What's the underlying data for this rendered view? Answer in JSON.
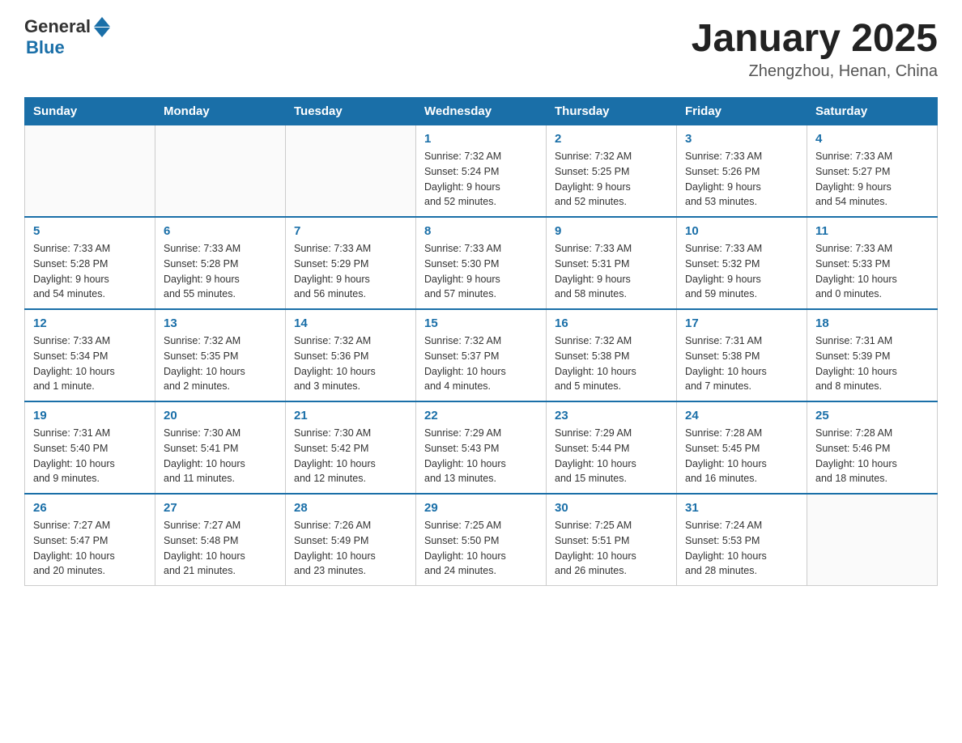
{
  "header": {
    "logo_general": "General",
    "logo_blue": "Blue",
    "month_title": "January 2025",
    "location": "Zhengzhou, Henan, China"
  },
  "weekdays": [
    "Sunday",
    "Monday",
    "Tuesday",
    "Wednesday",
    "Thursday",
    "Friday",
    "Saturday"
  ],
  "weeks": [
    [
      {
        "day": "",
        "info": ""
      },
      {
        "day": "",
        "info": ""
      },
      {
        "day": "",
        "info": ""
      },
      {
        "day": "1",
        "info": "Sunrise: 7:32 AM\nSunset: 5:24 PM\nDaylight: 9 hours\nand 52 minutes."
      },
      {
        "day": "2",
        "info": "Sunrise: 7:32 AM\nSunset: 5:25 PM\nDaylight: 9 hours\nand 52 minutes."
      },
      {
        "day": "3",
        "info": "Sunrise: 7:33 AM\nSunset: 5:26 PM\nDaylight: 9 hours\nand 53 minutes."
      },
      {
        "day": "4",
        "info": "Sunrise: 7:33 AM\nSunset: 5:27 PM\nDaylight: 9 hours\nand 54 minutes."
      }
    ],
    [
      {
        "day": "5",
        "info": "Sunrise: 7:33 AM\nSunset: 5:28 PM\nDaylight: 9 hours\nand 54 minutes."
      },
      {
        "day": "6",
        "info": "Sunrise: 7:33 AM\nSunset: 5:28 PM\nDaylight: 9 hours\nand 55 minutes."
      },
      {
        "day": "7",
        "info": "Sunrise: 7:33 AM\nSunset: 5:29 PM\nDaylight: 9 hours\nand 56 minutes."
      },
      {
        "day": "8",
        "info": "Sunrise: 7:33 AM\nSunset: 5:30 PM\nDaylight: 9 hours\nand 57 minutes."
      },
      {
        "day": "9",
        "info": "Sunrise: 7:33 AM\nSunset: 5:31 PM\nDaylight: 9 hours\nand 58 minutes."
      },
      {
        "day": "10",
        "info": "Sunrise: 7:33 AM\nSunset: 5:32 PM\nDaylight: 9 hours\nand 59 minutes."
      },
      {
        "day": "11",
        "info": "Sunrise: 7:33 AM\nSunset: 5:33 PM\nDaylight: 10 hours\nand 0 minutes."
      }
    ],
    [
      {
        "day": "12",
        "info": "Sunrise: 7:33 AM\nSunset: 5:34 PM\nDaylight: 10 hours\nand 1 minute."
      },
      {
        "day": "13",
        "info": "Sunrise: 7:32 AM\nSunset: 5:35 PM\nDaylight: 10 hours\nand 2 minutes."
      },
      {
        "day": "14",
        "info": "Sunrise: 7:32 AM\nSunset: 5:36 PM\nDaylight: 10 hours\nand 3 minutes."
      },
      {
        "day": "15",
        "info": "Sunrise: 7:32 AM\nSunset: 5:37 PM\nDaylight: 10 hours\nand 4 minutes."
      },
      {
        "day": "16",
        "info": "Sunrise: 7:32 AM\nSunset: 5:38 PM\nDaylight: 10 hours\nand 5 minutes."
      },
      {
        "day": "17",
        "info": "Sunrise: 7:31 AM\nSunset: 5:38 PM\nDaylight: 10 hours\nand 7 minutes."
      },
      {
        "day": "18",
        "info": "Sunrise: 7:31 AM\nSunset: 5:39 PM\nDaylight: 10 hours\nand 8 minutes."
      }
    ],
    [
      {
        "day": "19",
        "info": "Sunrise: 7:31 AM\nSunset: 5:40 PM\nDaylight: 10 hours\nand 9 minutes."
      },
      {
        "day": "20",
        "info": "Sunrise: 7:30 AM\nSunset: 5:41 PM\nDaylight: 10 hours\nand 11 minutes."
      },
      {
        "day": "21",
        "info": "Sunrise: 7:30 AM\nSunset: 5:42 PM\nDaylight: 10 hours\nand 12 minutes."
      },
      {
        "day": "22",
        "info": "Sunrise: 7:29 AM\nSunset: 5:43 PM\nDaylight: 10 hours\nand 13 minutes."
      },
      {
        "day": "23",
        "info": "Sunrise: 7:29 AM\nSunset: 5:44 PM\nDaylight: 10 hours\nand 15 minutes."
      },
      {
        "day": "24",
        "info": "Sunrise: 7:28 AM\nSunset: 5:45 PM\nDaylight: 10 hours\nand 16 minutes."
      },
      {
        "day": "25",
        "info": "Sunrise: 7:28 AM\nSunset: 5:46 PM\nDaylight: 10 hours\nand 18 minutes."
      }
    ],
    [
      {
        "day": "26",
        "info": "Sunrise: 7:27 AM\nSunset: 5:47 PM\nDaylight: 10 hours\nand 20 minutes."
      },
      {
        "day": "27",
        "info": "Sunrise: 7:27 AM\nSunset: 5:48 PM\nDaylight: 10 hours\nand 21 minutes."
      },
      {
        "day": "28",
        "info": "Sunrise: 7:26 AM\nSunset: 5:49 PM\nDaylight: 10 hours\nand 23 minutes."
      },
      {
        "day": "29",
        "info": "Sunrise: 7:25 AM\nSunset: 5:50 PM\nDaylight: 10 hours\nand 24 minutes."
      },
      {
        "day": "30",
        "info": "Sunrise: 7:25 AM\nSunset: 5:51 PM\nDaylight: 10 hours\nand 26 minutes."
      },
      {
        "day": "31",
        "info": "Sunrise: 7:24 AM\nSunset: 5:53 PM\nDaylight: 10 hours\nand 28 minutes."
      },
      {
        "day": "",
        "info": ""
      }
    ]
  ]
}
